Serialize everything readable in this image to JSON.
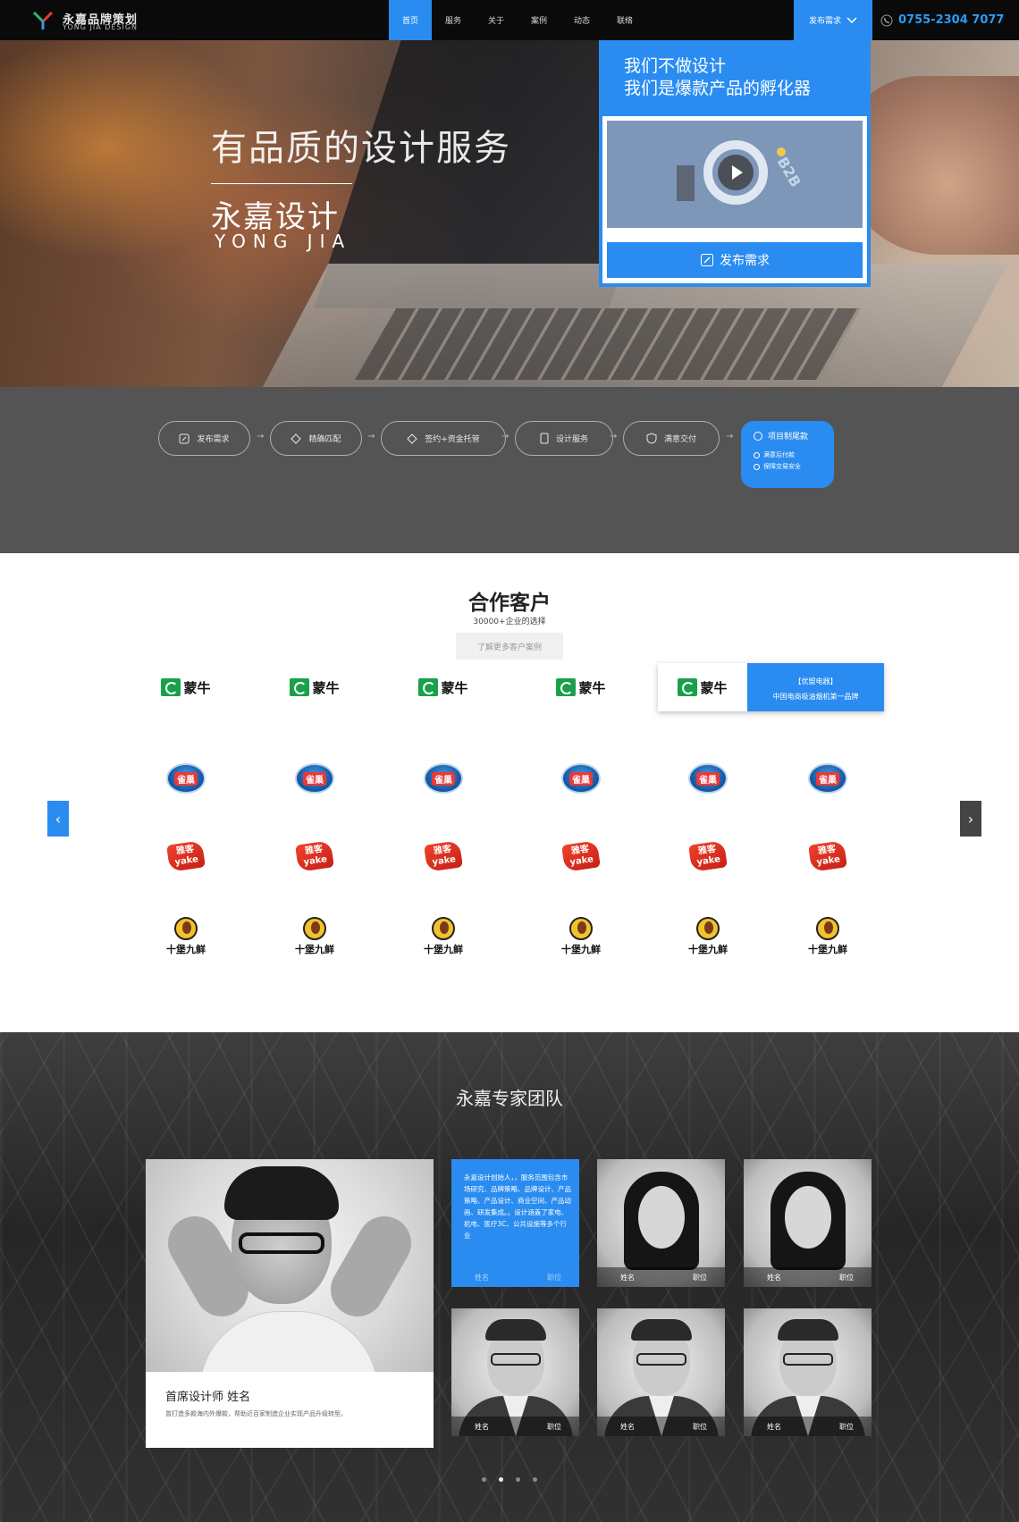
{
  "header": {
    "logo_title": "永嘉品牌策划",
    "logo_subtitle": "YONG JIA DESIGN",
    "nav": [
      "首页",
      "服务",
      "关于",
      "案例",
      "动态",
      "联络"
    ],
    "active_nav": "首页",
    "publish_dropdown": "发布需求",
    "phone": "0755-2304 7077",
    "colors": {
      "accent": "#2a8cf0",
      "phone": "#2a9cf5",
      "bar": "#0a0a0a"
    }
  },
  "hero": {
    "title": "有品质的设计服务",
    "brand": "永嘉设计",
    "pinyin": "YONG JIA",
    "promo_line1": "我们不做设计",
    "promo_line2": "我们是爆款产品的孵化器",
    "video_label": "B2B",
    "publish_button": "发布需求"
  },
  "process": {
    "steps": [
      {
        "label": "发布需求",
        "icon": "edit-icon"
      },
      {
        "label": "精确匹配",
        "icon": "diamond-icon"
      },
      {
        "label": "签约+资金托管",
        "icon": "diamond-icon"
      },
      {
        "label": "设计服务",
        "icon": "phone-icon"
      },
      {
        "label": "满意交付",
        "icon": "shield-icon"
      }
    ],
    "final_step": {
      "label": "项目制尾款",
      "items": [
        "满意后付款",
        "保障交易安全"
      ]
    }
  },
  "clients": {
    "title": "合作客户",
    "subtitle": "30000+企业的选择",
    "more_button": "了解更多客户案例",
    "rows": [
      {
        "brand": "蒙牛",
        "count": 6
      },
      {
        "brand": "雀巢",
        "count": 6
      },
      {
        "brand": "雅客",
        "count": 6
      },
      {
        "brand": "十堡九鲜",
        "count": 6
      }
    ],
    "logo_labels": {
      "mengniu": "蒙牛",
      "nestle": "雀巢",
      "yake_top": "雅客",
      "yake_bottom": "yake",
      "sbj": "十堡九鲜"
    },
    "hover_card": {
      "title": "【优盟电器】",
      "desc": "中国电商吸油烟机第一品牌"
    },
    "prev_arrow": "‹",
    "next_arrow": "›"
  },
  "team": {
    "title": "永嘉专家团队",
    "lead": {
      "name": "首席设计师 姓名",
      "desc": "曾打造多款海内外爆款，帮助近百家制造企业实现产品升级转型。"
    },
    "active_member_info": "永嘉设计创始人，，服务范围包含市场研究、品牌策略、品牌设计、产品策略、产品设计、商业空间、产品动画、研发集成。。设计涵盖了家电、机电、医疗3C、公共设施等多个行业",
    "members": [
      {
        "name": "姓名",
        "role": "职位"
      },
      {
        "name": "姓名",
        "role": "职位"
      },
      {
        "name": "姓名",
        "role": "职位"
      },
      {
        "name": "姓名",
        "role": "职位"
      },
      {
        "name": "姓名",
        "role": "职位"
      },
      {
        "name": "姓名",
        "role": "职位"
      }
    ],
    "dots": 4,
    "active_dot": 1
  }
}
